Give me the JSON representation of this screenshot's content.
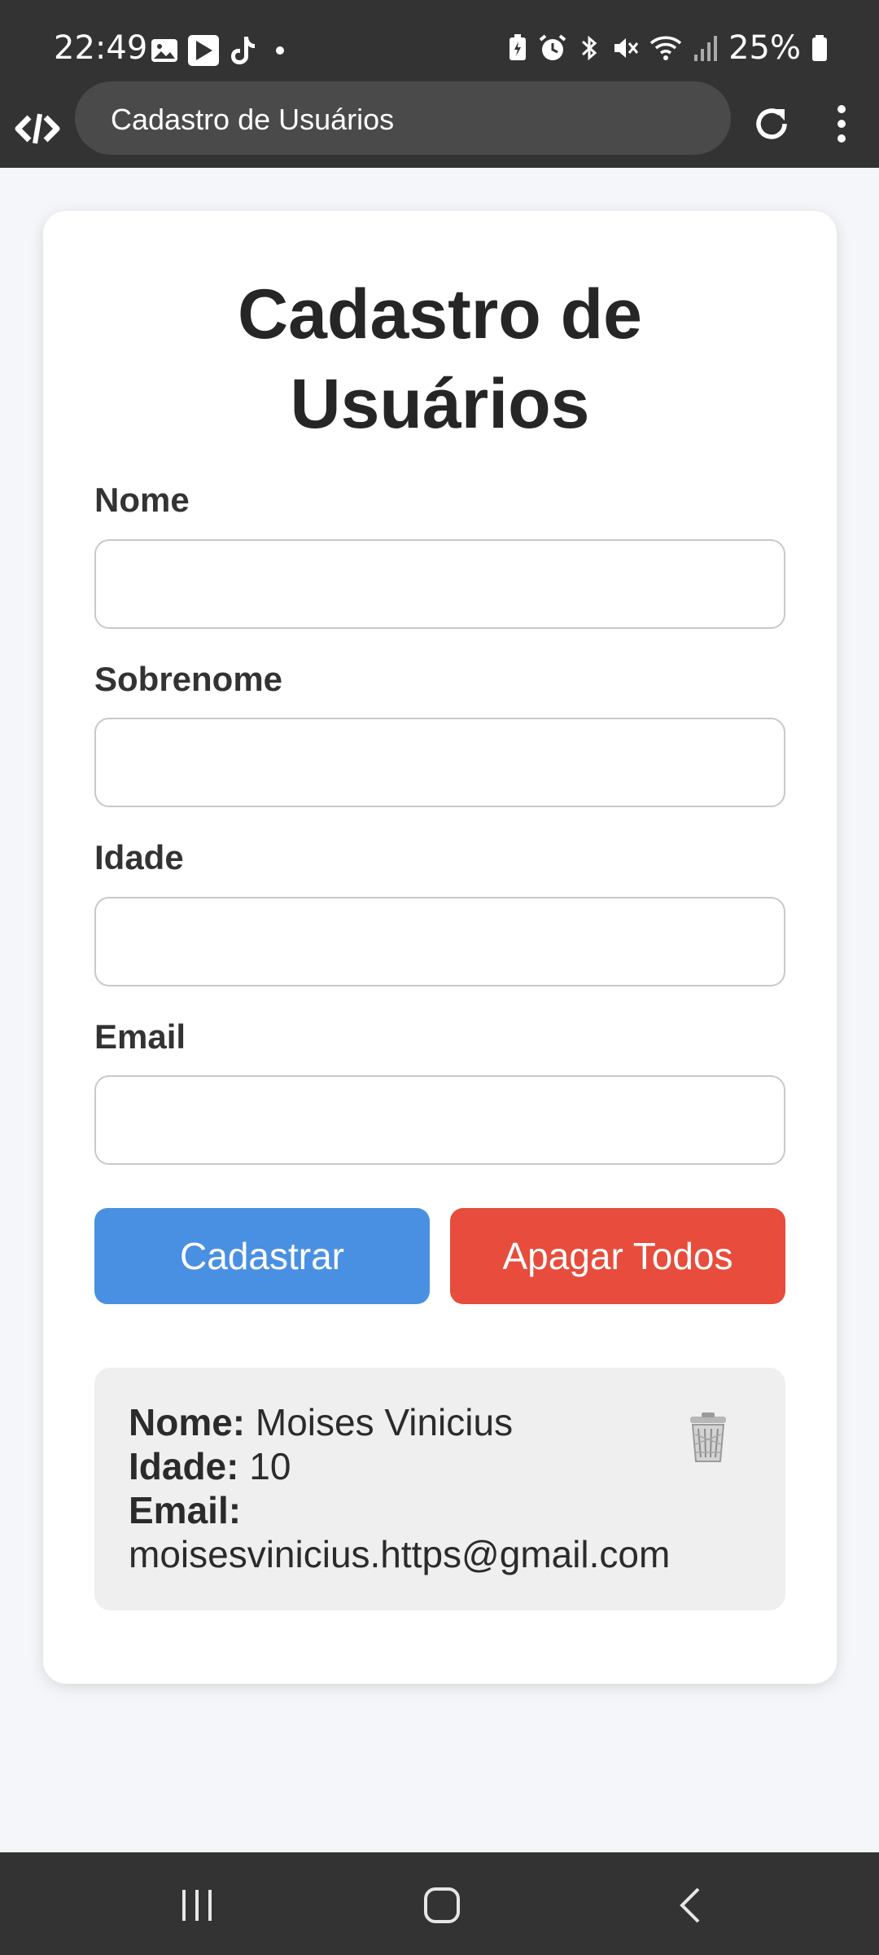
{
  "status_bar": {
    "time": "22:49",
    "battery": "25%",
    "left_icons": [
      "gallery-icon",
      "play-store-icon",
      "tiktok-icon",
      "dot-icon"
    ],
    "right_icons": [
      "battery-saver-icon",
      "alarm-icon",
      "bluetooth-icon",
      "mute-icon",
      "wifi-icon",
      "signal-icon",
      "battery-icon"
    ]
  },
  "browser": {
    "tab_title": "Cadastro de Usuários"
  },
  "form": {
    "title_line1": "Cadastro de",
    "title_line2": "Usuários",
    "fields": [
      {
        "label": "Nome",
        "value": "",
        "placeholder": ""
      },
      {
        "label": "Sobrenome",
        "value": "",
        "placeholder": ""
      },
      {
        "label": "Idade",
        "value": "",
        "placeholder": ""
      },
      {
        "label": "Email",
        "value": "",
        "placeholder": ""
      }
    ],
    "register_button": "Cadastrar",
    "clear_button": "Apagar Todos"
  },
  "users": [
    {
      "name_label": "Nome:",
      "name": "Moises Vinicius",
      "age_label": "Idade:",
      "age": "10",
      "email_label": "Email:",
      "email": "moisesvinicius.https@gmail.com"
    }
  ],
  "colors": {
    "register": "#4a90e2",
    "clear": "#e74c3c",
    "system_bar": "#333333"
  }
}
